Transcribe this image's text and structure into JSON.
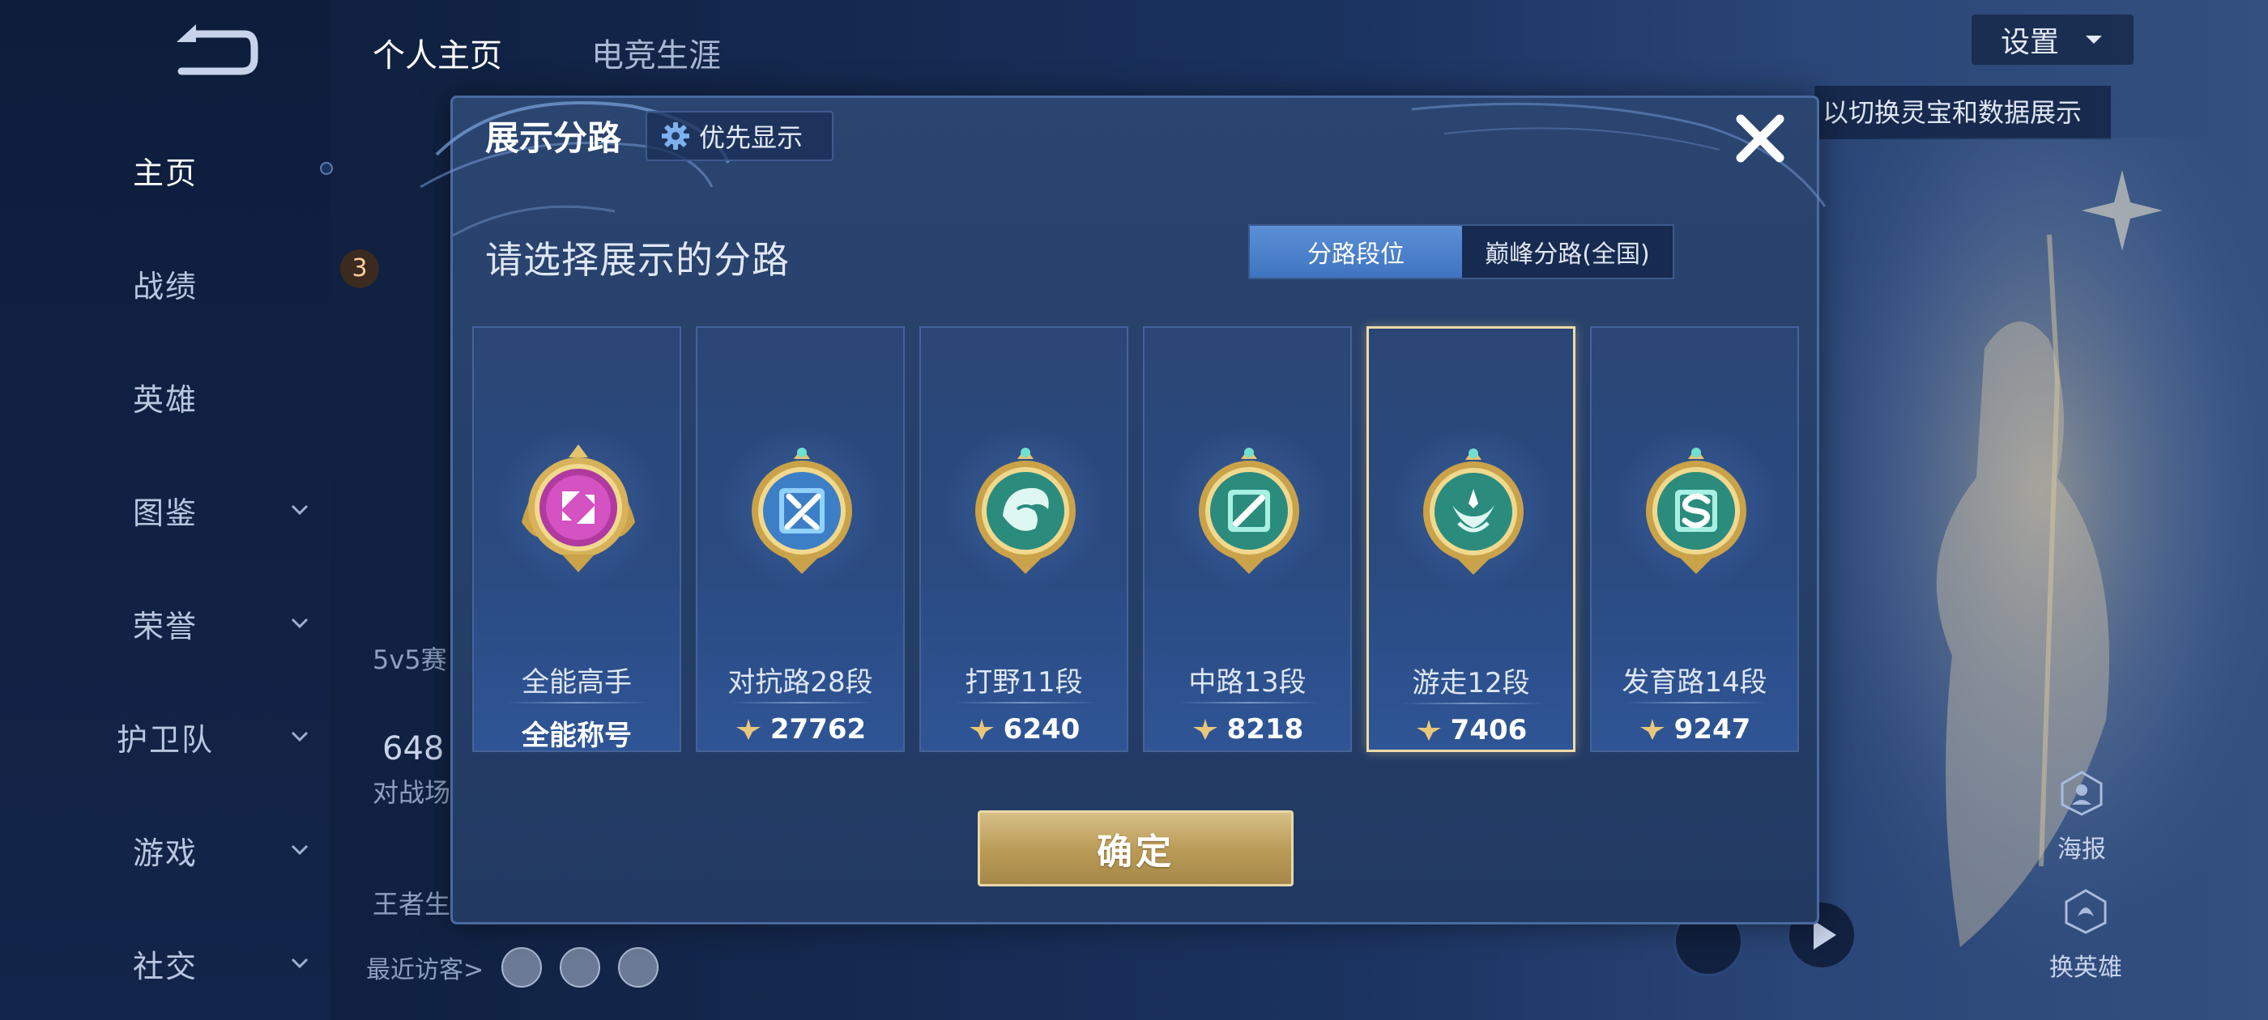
{
  "sidebar": {
    "items": [
      {
        "label": "主页",
        "active": true
      },
      {
        "label": "战绩"
      },
      {
        "label": "英雄"
      },
      {
        "label": "图鉴"
      },
      {
        "label": "荣誉"
      },
      {
        "label": "护卫队"
      },
      {
        "label": "游戏"
      },
      {
        "label": "社交"
      }
    ]
  },
  "background": {
    "tabs": [
      "个人主页",
      "电竞生涯"
    ],
    "settings_label": "设置",
    "hint_text": "以切换灵宝和数据展示",
    "badge_count": "3",
    "mode_text": "5v5赛",
    "stat_number": "648",
    "stat_label": "对战场",
    "legacy_label": "王者生",
    "visitors_label": "最近访客>",
    "poster_label": "海报",
    "change_hero_label": "换英雄"
  },
  "dialog": {
    "title": "展示分路",
    "priority_label": "优先显示",
    "section_title": "请选择展示的分路",
    "toggle": {
      "options": [
        "分路段位",
        "巅峰分路(全国)"
      ],
      "active": "分路段位"
    },
    "cards": [
      {
        "name": "全能高手",
        "value": "全能称号",
        "emblem": "allround-purple-emblem-icon",
        "selected": false
      },
      {
        "name": "对抗路28段",
        "value": "27762",
        "emblem": "clash-lane-emblem-icon",
        "selected": false
      },
      {
        "name": "打野11段",
        "value": "6240",
        "emblem": "jungle-emblem-icon",
        "selected": false
      },
      {
        "name": "中路13段",
        "value": "8218",
        "emblem": "mid-lane-emblem-icon",
        "selected": false
      },
      {
        "name": "游走12段",
        "value": "7406",
        "emblem": "roam-emblem-icon",
        "selected": true
      },
      {
        "name": "发育路14段",
        "value": "9247",
        "emblem": "farm-lane-emblem-icon",
        "selected": false
      }
    ],
    "confirm_label": "确定"
  },
  "colors": {
    "accent_blue": "#3f74c0",
    "gold": "#d6bf86",
    "selected_border": "#efd9a6",
    "emblem_teal": "#3fb8a8",
    "emblem_blue": "#6fb6f2",
    "emblem_purple": "#c43fb0"
  }
}
